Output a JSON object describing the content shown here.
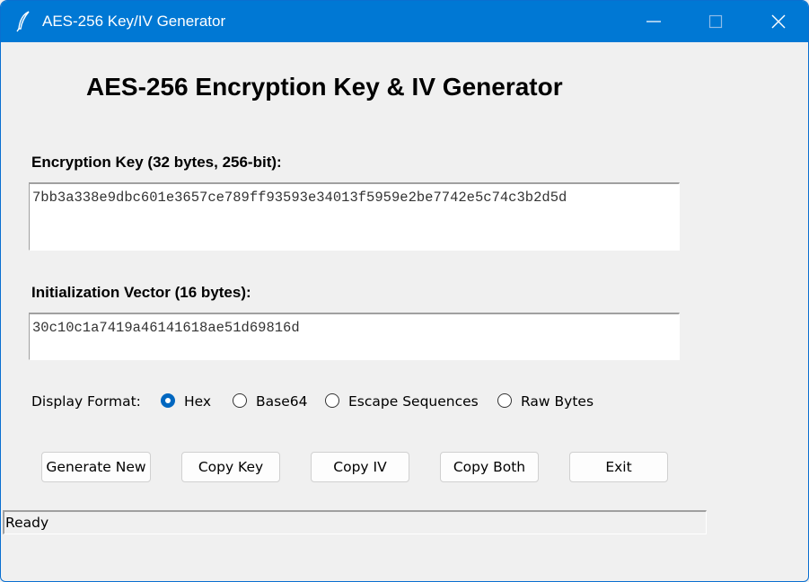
{
  "window": {
    "title": "AES-256 Key/IV Generator",
    "app_icon": "feather-icon",
    "controls": [
      "minimize-icon",
      "maximize-icon",
      "close-icon"
    ],
    "titlebar_color": "#0078d4"
  },
  "main": {
    "heading": "AES-256 Encryption Key & IV Generator",
    "key_label": "Encryption Key (32 bytes, 256-bit):",
    "key_value": "7bb3a338e9dbc601e3657ce789ff93593e34013f5959e2be7742e5c74c3b2d5d",
    "iv_label": "Initialization Vector (16 bytes):",
    "iv_value": "30c10c1a7419a46141618ae51d69816d"
  },
  "format": {
    "label": "Display Format:",
    "options": [
      "Hex",
      "Base64",
      "Escape Sequences",
      "Raw Bytes"
    ],
    "selected": "Hex",
    "accent": "#0067c0"
  },
  "buttons": {
    "generate": "Generate New",
    "copy_key": "Copy Key",
    "copy_iv": "Copy IV",
    "copy_both": "Copy Both",
    "exit": "Exit"
  },
  "status": {
    "text": "Ready"
  }
}
